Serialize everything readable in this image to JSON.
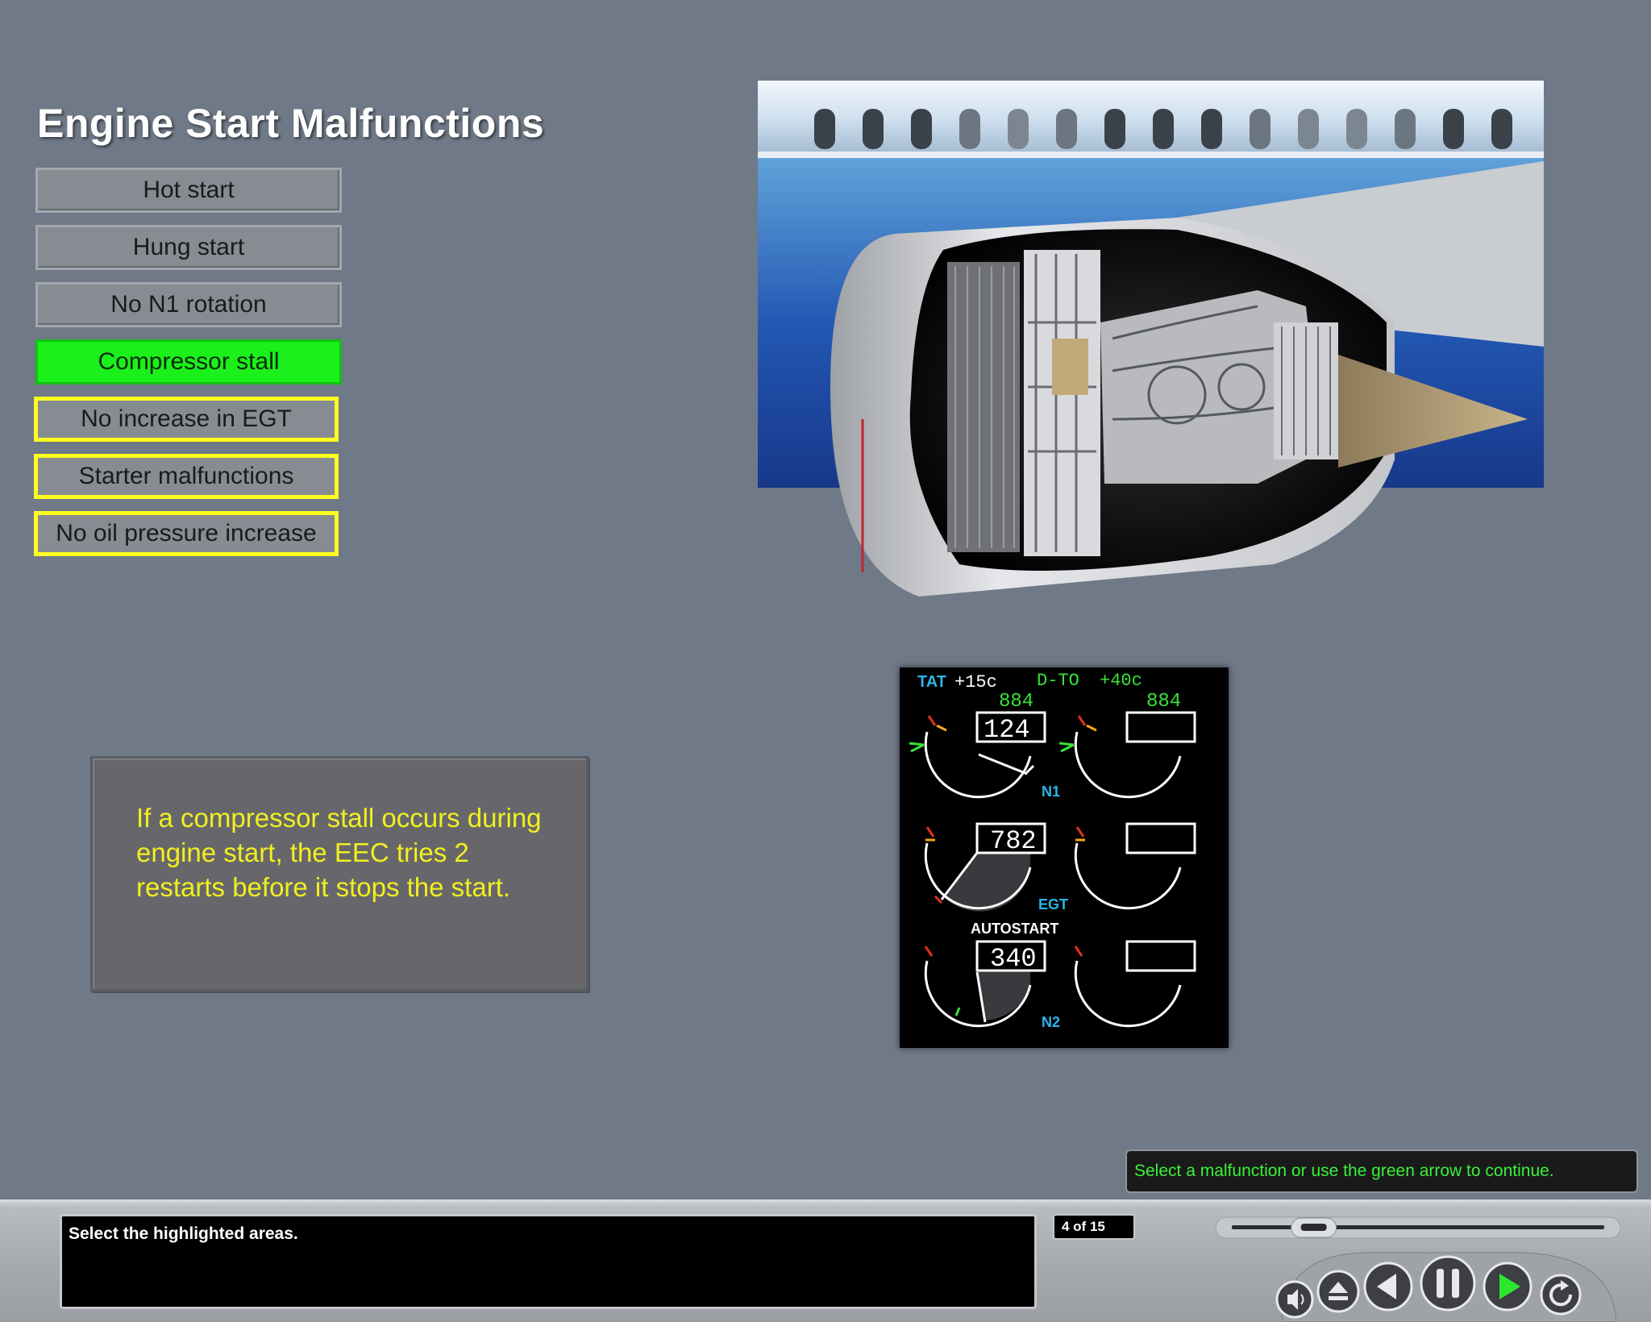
{
  "title": "Engine Start Malfunctions",
  "menu": [
    {
      "label": "Hot start",
      "state": "normal"
    },
    {
      "label": "Hung start",
      "state": "normal"
    },
    {
      "label": "No N1 rotation",
      "state": "normal"
    },
    {
      "label": "Compressor stall",
      "state": "active"
    },
    {
      "label": "No increase in EGT",
      "state": "highlighted"
    },
    {
      "label": "Starter malfunctions",
      "state": "highlighted"
    },
    {
      "label": "No oil pressure increase",
      "state": "highlighted"
    }
  ],
  "info_text": "If a compressor stall occurs during engine start, the EEC tries 2 restarts before it stops the start.",
  "display": {
    "tat_label": "TAT",
    "tat_value": "+15c",
    "mode": "D-TO",
    "assumed_temp": "+40c",
    "n1_limit_left": "884",
    "n1_limit_right": "884",
    "n1_value": "124",
    "egt_value": "782",
    "n2_value": "340",
    "n1_label": "N1",
    "egt_label": "EGT",
    "n2_label": "N2",
    "autostart_label": "AUTOSTART"
  },
  "prompt_text": "Select a malfunction or use the green arrow to continue.",
  "narration_text": "Select the highlighted areas.",
  "page_counter": "4 of 15",
  "progress": 0.22,
  "colors": {
    "active": "#1bf01b",
    "highlight": "#ffff1e",
    "info_text": "#f2ef1f",
    "prompt_text": "#39f239",
    "display_green": "#39e239",
    "display_cyan": "#2ab6e8"
  },
  "controls": [
    "volume-icon",
    "eject-icon",
    "back-icon",
    "pause-icon",
    "play-icon",
    "replay-icon"
  ]
}
